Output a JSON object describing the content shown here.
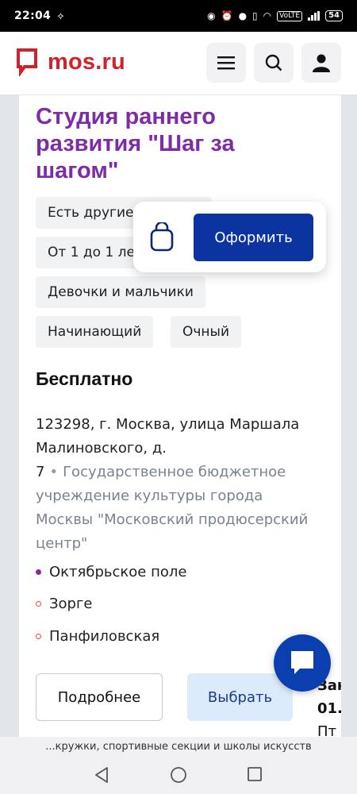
{
  "status_bar": {
    "time": "22:04",
    "volte": "VoLTE",
    "battery": "54"
  },
  "header": {
    "logo_text": "mos.ru"
  },
  "card": {
    "title": "Студия раннего развития \"Шаг за шагом\"",
    "tags": [
      "Есть другие",
      "От 1 до 1 ле",
      "Девочки и мальчики",
      "Начинающий",
      "Очный"
    ],
    "price": "Бесплатно",
    "address": "123298, г. Москва, улица Маршала Малиновского, д. 7",
    "address_separator": "•",
    "organization": "Государственное бюджетное учреждение культуры города Москвы \"Московский продюсерский центр\"",
    "metro": [
      {
        "name": "Октябрьское поле",
        "color": "#8b2a8f",
        "filled": true
      },
      {
        "name": "Зорге",
        "color": "#e0533e",
        "filled": false
      },
      {
        "name": "Панфиловская",
        "color": "#e0533e",
        "filled": false
      }
    ],
    "more_button": "Подробнее",
    "select_button": "Выбрать",
    "peek_text": [
      "Зан",
      "01.(",
      "Пт"
    ]
  },
  "popup": {
    "checkout_button": "Оформить"
  },
  "footer": {
    "text": "...кружки, спортивные секции и школы искусств"
  },
  "colors": {
    "brand_red": "#d1222c",
    "title_purple": "#7e2ba8",
    "primary_blue": "#0b34a0"
  }
}
